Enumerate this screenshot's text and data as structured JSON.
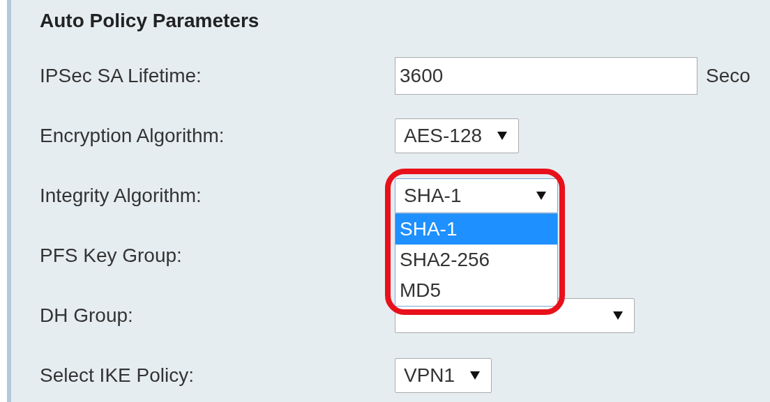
{
  "section": {
    "title": "Auto Policy Parameters"
  },
  "fields": [
    {
      "kind": "text",
      "label": "IPSec SA Lifetime:",
      "value": "3600",
      "unit": "Seco"
    },
    {
      "kind": "select",
      "label": "Encryption Algorithm:",
      "value": "AES-128",
      "open": false,
      "highlighted": false
    },
    {
      "kind": "select",
      "label": "Integrity Algorithm:",
      "value": "SHA-1",
      "open": true,
      "highlighted": true,
      "options": [
        {
          "label": "SHA-1",
          "selected": true
        },
        {
          "label": "SHA2-256",
          "selected": false
        },
        {
          "label": "MD5",
          "selected": false
        }
      ]
    },
    {
      "kind": "label",
      "label": "PFS Key Group:"
    },
    {
      "kind": "select",
      "label": "DH Group:",
      "open": false,
      "highlighted": false
    },
    {
      "kind": "select",
      "label": "Select IKE Policy:",
      "value": "VPN1",
      "open": false,
      "highlighted": false
    }
  ]
}
